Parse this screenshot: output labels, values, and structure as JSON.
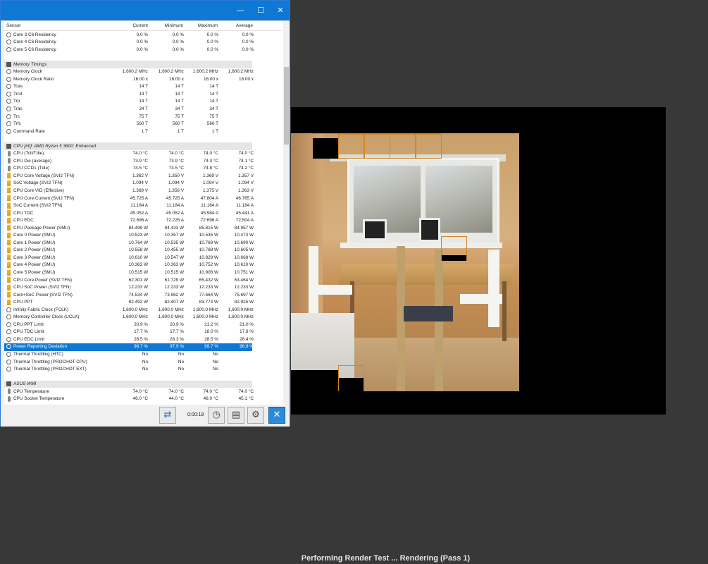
{
  "window": {
    "minimize": "—",
    "maximize": "☐",
    "close": "✕"
  },
  "columns": [
    "Sensor",
    "Current",
    "Minimum",
    "Maximum",
    "Average"
  ],
  "rows": [
    {
      "kind": "row",
      "icon": "circle",
      "name": "Core 3 C6 Residency",
      "v": [
        "0.0 %",
        "0.0 %",
        "0.0 %",
        "0.0 %"
      ]
    },
    {
      "kind": "row",
      "icon": "circle",
      "name": "Core 4 C6 Residency",
      "v": [
        "0.0 %",
        "0.0 %",
        "0.0 %",
        "0.0 %"
      ]
    },
    {
      "kind": "row",
      "icon": "circle",
      "name": "Core 5 C6 Residency",
      "v": [
        "0.0 %",
        "0.0 %",
        "0.0 %",
        "0.0 %"
      ]
    },
    {
      "kind": "blank"
    },
    {
      "kind": "group",
      "icon": "chip",
      "name": "Memory Timings"
    },
    {
      "kind": "row",
      "icon": "circle",
      "name": "Memory Clock",
      "v": [
        "1,600.2 MHz",
        "1,600.2 MHz",
        "1,600.2 MHz",
        "1,600.2 MHz"
      ]
    },
    {
      "kind": "row",
      "icon": "circle",
      "name": "Memory Clock Ratio",
      "v": [
        "16.00 x",
        "16.00 x",
        "16.00 x",
        "16.00 x"
      ]
    },
    {
      "kind": "row",
      "icon": "circle",
      "name": "Tcas",
      "v": [
        "14 T",
        "14 T",
        "14 T",
        ""
      ]
    },
    {
      "kind": "row",
      "icon": "circle",
      "name": "Trcd",
      "v": [
        "14 T",
        "14 T",
        "14 T",
        ""
      ]
    },
    {
      "kind": "row",
      "icon": "circle",
      "name": "Trp",
      "v": [
        "14 T",
        "14 T",
        "14 T",
        ""
      ]
    },
    {
      "kind": "row",
      "icon": "circle",
      "name": "Tras",
      "v": [
        "34 T",
        "34 T",
        "34 T",
        ""
      ]
    },
    {
      "kind": "row",
      "icon": "circle",
      "name": "Trc",
      "v": [
        "75 T",
        "75 T",
        "75 T",
        ""
      ]
    },
    {
      "kind": "row",
      "icon": "circle",
      "name": "Trfc",
      "v": [
        "560 T",
        "560 T",
        "560 T",
        ""
      ]
    },
    {
      "kind": "row",
      "icon": "circle",
      "name": "Command Rate",
      "v": [
        "1 T",
        "1 T",
        "1 T",
        ""
      ]
    },
    {
      "kind": "blank"
    },
    {
      "kind": "group",
      "icon": "chip",
      "name": "CPU [#0]: AMD Ryzen 5 3600: Enhanced"
    },
    {
      "kind": "row",
      "icon": "temp",
      "name": "CPU (Tctl/Tdie)",
      "v": [
        "74.0 °C",
        "74.0 °C",
        "74.0 °C",
        "74.0 °C"
      ]
    },
    {
      "kind": "row",
      "icon": "temp",
      "name": "CPU Die (average)",
      "v": [
        "73.9 °C",
        "73.9 °C",
        "74.3 °C",
        "74.1 °C"
      ]
    },
    {
      "kind": "row",
      "icon": "temp",
      "name": "CPU CCD1 (Tdie)",
      "v": [
        "74.5 °C",
        "73.5 °C",
        "74.8 °C",
        "74.2 °C"
      ]
    },
    {
      "kind": "row",
      "icon": "volt",
      "name": "CPU Core Voltage (SVI2 TFN)",
      "v": [
        "1.362 V",
        "1.350 V",
        "1.369 V",
        "1.357 V"
      ]
    },
    {
      "kind": "row",
      "icon": "volt",
      "name": "SoC Voltage (SVI2 TFN)",
      "v": [
        "1.094 V",
        "1.094 V",
        "1.094 V",
        "1.094 V"
      ]
    },
    {
      "kind": "row",
      "icon": "volt",
      "name": "CPU Core VID (Effective)",
      "v": [
        "1.369 V",
        "1.356 V",
        "1.375 V",
        "1.363 V"
      ]
    },
    {
      "kind": "row",
      "icon": "volt",
      "name": "CPU Core Current (SVI2 TFN)",
      "v": [
        "45.725 A",
        "45.725 A",
        "47.804 A",
        "46.765 A"
      ]
    },
    {
      "kind": "row",
      "icon": "volt",
      "name": "SoC Current (SVI2 TFN)",
      "v": [
        "11.184 A",
        "11.184 A",
        "11.184 A",
        "11.184 A"
      ]
    },
    {
      "kind": "row",
      "icon": "volt",
      "name": "CPU TDC",
      "v": [
        "45.052 A",
        "45.052 A",
        "45.984 A",
        "45.441 A"
      ]
    },
    {
      "kind": "row",
      "icon": "volt",
      "name": "CPU EDC",
      "v": [
        "72.696 A",
        "72.225 A",
        "72.696 A",
        "72.504 A"
      ]
    },
    {
      "kind": "row",
      "icon": "volt",
      "name": "CPU Package Power (SMU)",
      "v": [
        "84.499 W",
        "84.433 W",
        "85.815 W",
        "84.957 W"
      ]
    },
    {
      "kind": "row",
      "icon": "volt",
      "name": "Core 0 Power (SMU)",
      "v": [
        "10.523 W",
        "10.357 W",
        "10.535 W",
        "10.473 W"
      ]
    },
    {
      "kind": "row",
      "icon": "volt",
      "name": "Core 1 Power (SMU)",
      "v": [
        "10.764 W",
        "10.535 W",
        "10.769 W",
        "10.690 W"
      ]
    },
    {
      "kind": "row",
      "icon": "volt",
      "name": "Core 2 Power (SMU)",
      "v": [
        "10.558 W",
        "10.455 W",
        "10.788 W",
        "10.605 W"
      ]
    },
    {
      "kind": "row",
      "icon": "volt",
      "name": "Core 3 Power (SMU)",
      "v": [
        "10.610 W",
        "10.547 W",
        "10.828 W",
        "10.668 W"
      ]
    },
    {
      "kind": "row",
      "icon": "volt",
      "name": "Core 4 Power (SMU)",
      "v": [
        "10.363 W",
        "10.363 W",
        "10.752 W",
        "10.610 W"
      ]
    },
    {
      "kind": "row",
      "icon": "volt",
      "name": "Core 5 Power (SMU)",
      "v": [
        "10.515 W",
        "10.515 W",
        "10.906 W",
        "10.751 W"
      ]
    },
    {
      "kind": "row",
      "icon": "volt",
      "name": "CPU Core Power (SVI2 TFN)",
      "v": [
        "62.301 W",
        "61.729 W",
        "65.432 W",
        "63.464 W"
      ]
    },
    {
      "kind": "row",
      "icon": "volt",
      "name": "CPU SoC Power (SVI2 TFN)",
      "v": [
        "12.233 W",
        "12.233 W",
        "12.233 W",
        "12.233 W"
      ]
    },
    {
      "kind": "row",
      "icon": "volt",
      "name": "Core+SoC Power (SVI2 TFN)",
      "v": [
        "74.534 W",
        "73.962 W",
        "77.664 W",
        "75.697 W"
      ]
    },
    {
      "kind": "row",
      "icon": "volt",
      "name": "CPU PPT",
      "v": [
        "82.492 W",
        "82.407 W",
        "83.774 W",
        "82.925 W"
      ]
    },
    {
      "kind": "row",
      "icon": "circle",
      "name": "Infinity Fabric Clock (FCLK)",
      "v": [
        "1,600.0 MHz",
        "1,600.0 MHz",
        "1,600.0 MHz",
        "1,600.0 MHz"
      ]
    },
    {
      "kind": "row",
      "icon": "circle",
      "name": "Memory Controller Clock (UCLK)",
      "v": [
        "1,600.0 MHz",
        "1,600.0 MHz",
        "1,600.0 MHz",
        "1,600.0 MHz"
      ]
    },
    {
      "kind": "row",
      "icon": "circle",
      "name": "CPU PPT Limit",
      "v": [
        "20.9 %",
        "20.9 %",
        "21.2 %",
        "21.0 %"
      ]
    },
    {
      "kind": "row",
      "icon": "circle",
      "name": "CPU TDC Limit",
      "v": [
        "17.7 %",
        "17.7 %",
        "18.0 %",
        "17.8 %"
      ]
    },
    {
      "kind": "row",
      "icon": "circle",
      "name": "CPU EDC Limit",
      "v": [
        "28.5 %",
        "28.3 %",
        "28.5 %",
        "28.4 %"
      ]
    },
    {
      "kind": "row",
      "icon": "circle",
      "name": "Power Reporting Deviation",
      "v": [
        "98.7 %",
        "97.9 %",
        "99.7 %",
        "98.8 %"
      ],
      "selected": true
    },
    {
      "kind": "row",
      "icon": "circle",
      "name": "Thermal Throttling (HTC)",
      "v": [
        "No",
        "No",
        "No",
        ""
      ]
    },
    {
      "kind": "row",
      "icon": "circle",
      "name": "Thermal Throttling (PROCHOT CPU)",
      "v": [
        "No",
        "No",
        "No",
        ""
      ]
    },
    {
      "kind": "row",
      "icon": "circle",
      "name": "Thermal Throttling (PROCHOT EXT)",
      "v": [
        "No",
        "No",
        "No",
        ""
      ]
    },
    {
      "kind": "blank"
    },
    {
      "kind": "group",
      "icon": "chip",
      "name": "ASUS WMI"
    },
    {
      "kind": "row",
      "icon": "temp",
      "name": "CPU Temperature",
      "v": [
        "74.0 °C",
        "74.0 °C",
        "74.0 °C",
        "74.0 °C"
      ]
    },
    {
      "kind": "row",
      "icon": "temp",
      "name": "CPU Socket Temperature",
      "v": [
        "46.0 °C",
        "44.0 °C",
        "46.0 °C",
        "45.1 °C"
      ]
    }
  ],
  "toolbar": {
    "timer": "0:00:18",
    "network_icon": "⇄",
    "clock_icon": "◷",
    "report_icon": "▤",
    "settings_icon": "⚙",
    "close_icon": "✕"
  },
  "status": "Performing Render Test ... Rendering (Pass 1)"
}
